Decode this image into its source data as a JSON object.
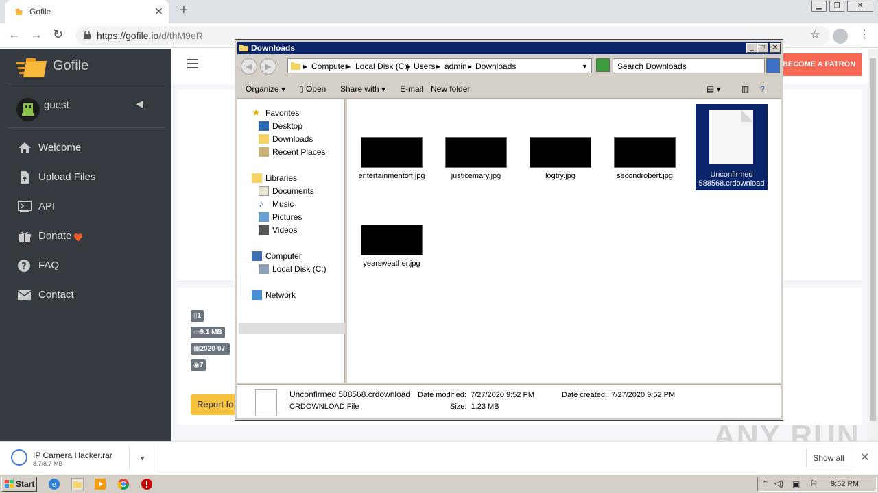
{
  "browser": {
    "tab_title": "Gofile",
    "url_host": "https://gofile.io",
    "url_path": "/d/thM9eR"
  },
  "sidebar": {
    "brand": "Gofile",
    "user": "guest",
    "items": [
      {
        "label": "Welcome",
        "icon": "home-icon"
      },
      {
        "label": "Upload Files",
        "icon": "file-upload-icon"
      },
      {
        "label": "API",
        "icon": "api-icon"
      },
      {
        "label": "Donate",
        "icon": "gift-icon"
      },
      {
        "label": "FAQ",
        "icon": "question-icon"
      },
      {
        "label": "Contact",
        "icon": "envelope-icon"
      }
    ]
  },
  "page": {
    "patron_label": "BECOME A PATRON",
    "badges": [
      "1",
      "9.1 MB",
      "2020-07-",
      "7"
    ],
    "report_label": "Report fo"
  },
  "explorer": {
    "title": "Downloads",
    "breadcrumb": [
      "Computer",
      "Local Disk (C:)",
      "Users",
      "admin",
      "Downloads"
    ],
    "search_placeholder": "Search Downloads",
    "commands": {
      "organize": "Organize",
      "open": "Open",
      "share_with": "Share with",
      "email": "E-mail",
      "new_folder": "New folder"
    },
    "nav": {
      "favorites": "Favorites",
      "desktop": "Desktop",
      "downloads": "Downloads",
      "recent": "Recent Places",
      "libraries": "Libraries",
      "documents": "Documents",
      "music": "Music",
      "pictures": "Pictures",
      "videos": "Videos",
      "computer": "Computer",
      "local_disk": "Local Disk (C:)",
      "network": "Network"
    },
    "files": [
      "entertainmentoff.jpg",
      "justicemary.jpg",
      "logtry.jpg",
      "secondrobert.jpg",
      "yearsweather.jpg"
    ],
    "selected_file_line1": "Unconfirmed",
    "selected_file_line2": "588568.crdownload",
    "details": {
      "name": "Unconfirmed 588568.crdownload",
      "type": "CRDOWNLOAD File",
      "modified_label": "Date modified:",
      "modified": "7/27/2020 9:52 PM",
      "created_label": "Date created:",
      "created": "7/27/2020 9:52 PM",
      "size_label": "Size:",
      "size": "1.23 MB"
    }
  },
  "downloads_bar": {
    "file": "IP Camera Hacker.rar",
    "progress": "8.7/8.7 MB",
    "show_all": "Show all"
  },
  "taskbar": {
    "start": "Start",
    "time": "9:52 PM"
  },
  "watermark": "ANY RUN"
}
